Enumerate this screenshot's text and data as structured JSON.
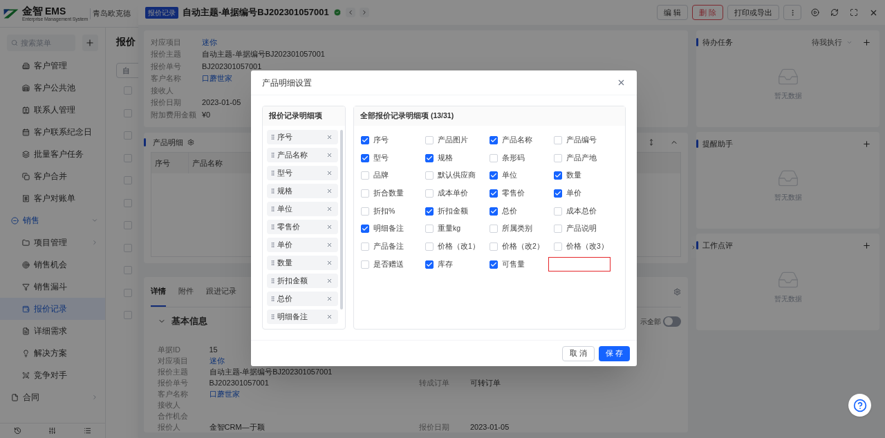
{
  "header": {
    "brand": "金智",
    "brand_suffix": "EMS",
    "tagline": "Enterprise Management System",
    "company": "青岛欧克德"
  },
  "sidebar": {
    "search_placeholder": "搜索菜单",
    "items": [
      {
        "label": "客户管理",
        "kind": "item",
        "selected": false
      },
      {
        "label": "客户公共池",
        "kind": "item",
        "selected": false
      },
      {
        "label": "联系人管理",
        "kind": "item",
        "selected": false
      },
      {
        "label": "客户联系纪念日",
        "kind": "item",
        "selected": false
      },
      {
        "label": "批量客户任务",
        "kind": "item",
        "selected": false
      },
      {
        "label": "客户合并",
        "kind": "item",
        "selected": false
      },
      {
        "label": "客户对账单",
        "kind": "item",
        "selected": false
      },
      {
        "label": "销售",
        "kind": "group",
        "selected": false,
        "expanded": true
      },
      {
        "label": "项目管理",
        "kind": "folder",
        "selected": false,
        "expanded": false
      },
      {
        "label": "销售机会",
        "kind": "item",
        "selected": false
      },
      {
        "label": "销售漏斗",
        "kind": "item",
        "selected": false
      },
      {
        "label": "报价记录",
        "kind": "item",
        "selected": true
      },
      {
        "label": "详细需求",
        "kind": "item",
        "selected": false
      },
      {
        "label": "解决方案",
        "kind": "item",
        "selected": false
      },
      {
        "label": "竞争对手",
        "kind": "item",
        "selected": false
      },
      {
        "label": "合同",
        "kind": "group",
        "selected": false,
        "expanded": false
      }
    ]
  },
  "list_page": {
    "title": "报价",
    "filter_value": "自",
    "rows": [
      {
        "checked": false
      },
      {
        "checked": false
      },
      {
        "checked": false
      },
      {
        "checked": false
      },
      {
        "checked": false
      },
      {
        "checked": false
      },
      {
        "checked": false
      },
      {
        "checked": false
      },
      {
        "checked": false
      },
      {
        "checked": false
      },
      {
        "checked": false
      }
    ]
  },
  "drawer": {
    "badge": "报价记录",
    "title": "自动主题-单据编号BJ202301057001",
    "verified": true,
    "actions": [
      {
        "label": "编 辑",
        "kind": "default"
      },
      {
        "label": "删 除",
        "kind": "danger"
      },
      {
        "label": "打印或导出",
        "kind": "default"
      }
    ],
    "summary": [
      {
        "label": "对应项目",
        "value": "迷你",
        "link": true
      },
      {
        "label": "报价主题",
        "value": "自动主题-单据编号BJ202301057001",
        "link": false
      },
      {
        "label": "报价单号",
        "value": "BJ202301057001",
        "link": false
      },
      {
        "label": "客户名称",
        "value": "口蘑世家",
        "link": true
      },
      {
        "label": "接收人"
      },
      {
        "label": "报价日期",
        "value": "2023-01-05",
        "link": false
      },
      {
        "label": "附加费用金额",
        "value": "¥0",
        "link": false
      }
    ],
    "product_detail": {
      "title": "产品明细",
      "columns": [
        "序号",
        "产品名称"
      ]
    },
    "tabs": [
      {
        "label": "详情",
        "selected": true
      },
      {
        "label": "附件",
        "selected": false
      },
      {
        "label": "跟进记录",
        "selected": false
      }
    ],
    "show_all": {
      "label": "示全部",
      "on": false
    },
    "basic_info": {
      "title": "基本信息",
      "expanded": true,
      "fields": [
        {
          "label": "单据ID",
          "value": "15",
          "link": false
        },
        {
          "label": "对应项目",
          "value": "迷你",
          "link": true
        },
        {
          "label": "报价主题",
          "value": "自动主题-单据编号BJ202301057001",
          "link": false
        },
        {
          "label": "报价单号",
          "value": "BJ202301057001",
          "link": false,
          "side": {
            "label": "转成订单",
            "value": "可转订单"
          }
        },
        {
          "label": "客户名称",
          "value": "口蘑世家",
          "link": true
        },
        {
          "label": "接收人"
        },
        {
          "label": "合作机会"
        },
        {
          "label": "报价人",
          "value": "金智CRM—于颖",
          "link": false,
          "side": {
            "label": "报价日期",
            "value": "2023-01-05"
          }
        }
      ]
    },
    "side_panels": [
      {
        "title": "待办任务",
        "filter": "待我执行",
        "empty_text": "暂无数据"
      },
      {
        "title": "提醒助手",
        "empty_text": "暂无数据"
      },
      {
        "title": "工作点评",
        "empty_text": "暂无数据"
      }
    ]
  },
  "modal": {
    "title": "产品明细设置",
    "selected_title": "报价记录明细项",
    "selected_items": [
      "序号",
      "产品名称",
      "型号",
      "规格",
      "单位",
      "零售价",
      "单价",
      "数量",
      "折扣金额",
      "总价",
      "明细备注"
    ],
    "all_title": "全部报价记录明细项 (13/31)",
    "options": [
      {
        "label": "序号",
        "checked": true
      },
      {
        "label": "产品图片",
        "checked": false
      },
      {
        "label": "产品名称",
        "checked": true
      },
      {
        "label": "产品编号",
        "checked": false
      },
      {
        "label": "型号",
        "checked": true
      },
      {
        "label": "规格",
        "checked": true
      },
      {
        "label": "条形码",
        "checked": false
      },
      {
        "label": "产品产地",
        "checked": false
      },
      {
        "label": "品牌",
        "checked": false
      },
      {
        "label": "默认供应商",
        "checked": false
      },
      {
        "label": "单位",
        "checked": true
      },
      {
        "label": "数量",
        "checked": true
      },
      {
        "label": "折合数量",
        "checked": false
      },
      {
        "label": "成本单价",
        "checked": false
      },
      {
        "label": "零售价",
        "checked": true
      },
      {
        "label": "单价",
        "checked": true
      },
      {
        "label": "折扣%",
        "checked": false
      },
      {
        "label": "折扣金额",
        "checked": true
      },
      {
        "label": "总价",
        "checked": true
      },
      {
        "label": "成本总价",
        "checked": false
      },
      {
        "label": "明细备注",
        "checked": true
      },
      {
        "label": "重量kg",
        "checked": false
      },
      {
        "label": "所属类别",
        "checked": false
      },
      {
        "label": "产品说明",
        "checked": false
      },
      {
        "label": "产品备注",
        "checked": false
      },
      {
        "label": "价格（改1）",
        "checked": false
      },
      {
        "label": "价格（改2）",
        "checked": false
      },
      {
        "label": "价格（改3）",
        "checked": false
      },
      {
        "label": "是否赠送",
        "checked": false
      },
      {
        "label": "库存",
        "checked": true
      },
      {
        "label": "可售量",
        "checked": true
      }
    ],
    "highlight_empty_slot": true,
    "buttons": [
      {
        "label": "取 消",
        "kind": "secondary"
      },
      {
        "label": "保 存",
        "kind": "primary"
      }
    ]
  }
}
